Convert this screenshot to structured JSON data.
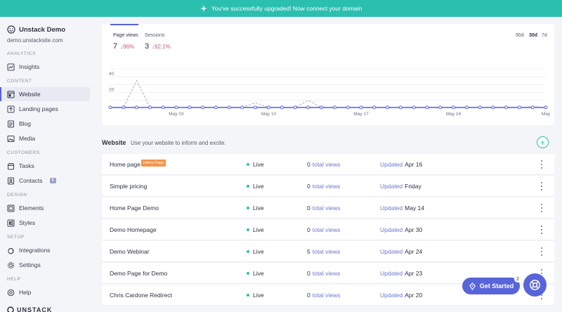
{
  "banner": {
    "text": "You've successfully upgraded! Now connect your domain"
  },
  "sidebar": {
    "site_name": "Unstack Demo",
    "domain": "demo.unstacksite.com",
    "sections": [
      {
        "title": "ANALYTICS",
        "items": [
          {
            "label": "Insights",
            "icon": "insights-icon"
          }
        ]
      },
      {
        "title": "CONTENT",
        "items": [
          {
            "label": "Website",
            "icon": "website-icon",
            "active": true
          },
          {
            "label": "Landing pages",
            "icon": "landing-pages-icon"
          },
          {
            "label": "Blog",
            "icon": "blog-icon"
          },
          {
            "label": "Media",
            "icon": "media-icon"
          }
        ]
      },
      {
        "title": "CUSTOMERS",
        "items": [
          {
            "label": "Tasks",
            "icon": "tasks-icon"
          },
          {
            "label": "Contacts",
            "icon": "contacts-icon",
            "badge": "6"
          }
        ]
      },
      {
        "title": "DESIGN",
        "items": [
          {
            "label": "Elements",
            "icon": "elements-icon"
          },
          {
            "label": "Styles",
            "icon": "styles-icon"
          }
        ]
      },
      {
        "title": "SETUP",
        "items": [
          {
            "label": "Integrations",
            "icon": "integrations-icon"
          },
          {
            "label": "Settings",
            "icon": "settings-icon"
          }
        ]
      },
      {
        "title": "HELP",
        "items": [
          {
            "label": "Help",
            "icon": "help-icon"
          }
        ]
      }
    ],
    "footer_logo": "UNSTACK"
  },
  "chart": {
    "metrics": [
      {
        "label": "Page views",
        "value": "7",
        "change": "↓96%"
      },
      {
        "label": "Sessions",
        "value": "3",
        "change": "↓92.1%"
      }
    ],
    "ranges": [
      "90d",
      "30d",
      "7d"
    ],
    "selected_range": "30d"
  },
  "chart_data": {
    "type": "line",
    "title": "",
    "xlabel": "",
    "ylabel": "",
    "ylim": [
      0,
      50
    ],
    "grid": true,
    "x_tick_labels": [
      "May 03",
      "May 10",
      "May 17",
      "May 24",
      "May"
    ],
    "y_tick_labels": [
      "40",
      "20"
    ],
    "x": [
      "Apr 28",
      "Apr 29",
      "Apr 30",
      "May 01",
      "May 02",
      "May 03",
      "May 04",
      "May 05",
      "May 06",
      "May 07",
      "May 08",
      "May 09",
      "May 10",
      "May 11",
      "May 12",
      "May 13",
      "May 14",
      "May 15",
      "May 16",
      "May 17",
      "May 18",
      "May 19",
      "May 20",
      "May 21",
      "May 22",
      "May 23",
      "May 24",
      "May 25",
      "May 26",
      "May 27",
      "May 28",
      "May 29",
      "May 30",
      "May 31"
    ],
    "series": [
      {
        "values": [
          1,
          1,
          1,
          1,
          1,
          1,
          1,
          1,
          1,
          1,
          1,
          1,
          1,
          1,
          1,
          1,
          1,
          1,
          1,
          1,
          1,
          1,
          1,
          1,
          1,
          1,
          1,
          1,
          1,
          1,
          1,
          1,
          1,
          1
        ]
      },
      {
        "values": [
          1,
          1,
          35,
          1,
          1,
          1,
          1,
          1,
          1,
          1,
          1,
          7,
          1,
          1,
          1,
          10,
          1,
          1,
          1,
          1,
          1,
          1,
          1,
          1,
          1,
          1,
          1,
          1,
          1,
          1,
          1,
          1,
          2,
          1
        ]
      }
    ],
    "colors": {
      "primary": "#5865d9",
      "secondary": "#a8abc4"
    }
  },
  "website": {
    "title": "Website",
    "subtitle": "Use your website to inform and excite.",
    "rows": [
      {
        "name": "Home page",
        "tag": "Home Page",
        "status": "Live",
        "views": "0",
        "views_label": "total views",
        "updated_label": "Updated",
        "updated": "Apr 16"
      },
      {
        "name": "Simple pricing",
        "tag": "",
        "status": "Live",
        "views": "0",
        "views_label": "total views",
        "updated_label": "Updated",
        "updated": "Friday"
      },
      {
        "name": "Home Page Demo",
        "tag": "",
        "status": "Live",
        "views": "0",
        "views_label": "total views",
        "updated_label": "Updated",
        "updated": "May 14"
      },
      {
        "name": "Demo Homepage",
        "tag": "",
        "status": "Live",
        "views": "0",
        "views_label": "total views",
        "updated_label": "Updated",
        "updated": "Apr 30"
      },
      {
        "name": "Demo Webinar",
        "tag": "",
        "status": "Live",
        "views": "5",
        "views_label": "total views",
        "updated_label": "Updated",
        "updated": "Apr 24"
      },
      {
        "name": "Demo Page for Demo",
        "tag": "",
        "status": "Live",
        "views": "0",
        "views_label": "total views",
        "updated_label": "Updated",
        "updated": "Apr 23"
      },
      {
        "name": "Chris Cardone Redirect",
        "tag": "",
        "status": "Live",
        "views": "0",
        "views_label": "total views",
        "updated_label": "Updated",
        "updated": "Apr 20"
      }
    ]
  },
  "get_started": {
    "label": "Get Started",
    "count": "2"
  },
  "colors": {
    "accent": "#5865d9",
    "teal": "#2bbfb0",
    "tag": "#f3944b",
    "change": "#c45a8c"
  }
}
